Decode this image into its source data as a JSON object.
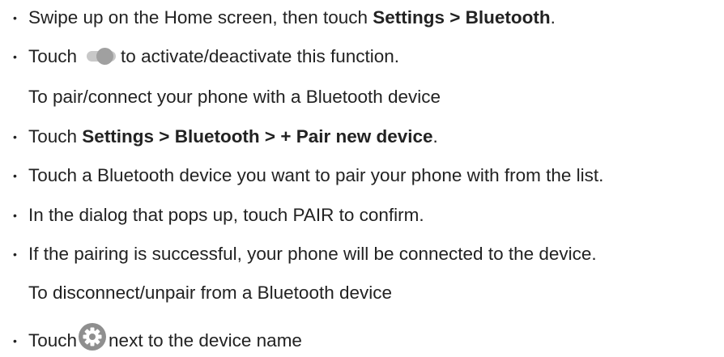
{
  "bullet_glyph": "•",
  "items": [
    {
      "before": "Swipe up on the Home screen, then touch ",
      "bold": "Settings > Bluetooth",
      "after": "."
    },
    {
      "before": "Touch",
      "icon": "toggle-switch-icon",
      "after": "to activate/deactivate this function."
    },
    {
      "heading": "To pair/connect your phone with a Bluetooth device"
    },
    {
      "before": "Touch ",
      "bold": "Settings > Bluetooth > + Pair new device",
      "after": "."
    },
    {
      "text": "Touch a Bluetooth device you want to pair your phone with from the list."
    },
    {
      "text": "In the dialog that pops up, touch PAIR to confirm."
    },
    {
      "text": "If the pairing is successful, your phone will be connected to the device."
    },
    {
      "heading": "To disconnect/unpair from a Bluetooth device"
    },
    {
      "before": "Touch",
      "icon": "gear-settings-icon",
      "after": "next to the device name"
    }
  ],
  "colors": {
    "text": "#222222",
    "toggle_track": "#c8c8c8",
    "toggle_knob": "#a0a0a0",
    "gear_bg": "#8f8f8f",
    "gear_fg": "#ffffff"
  }
}
